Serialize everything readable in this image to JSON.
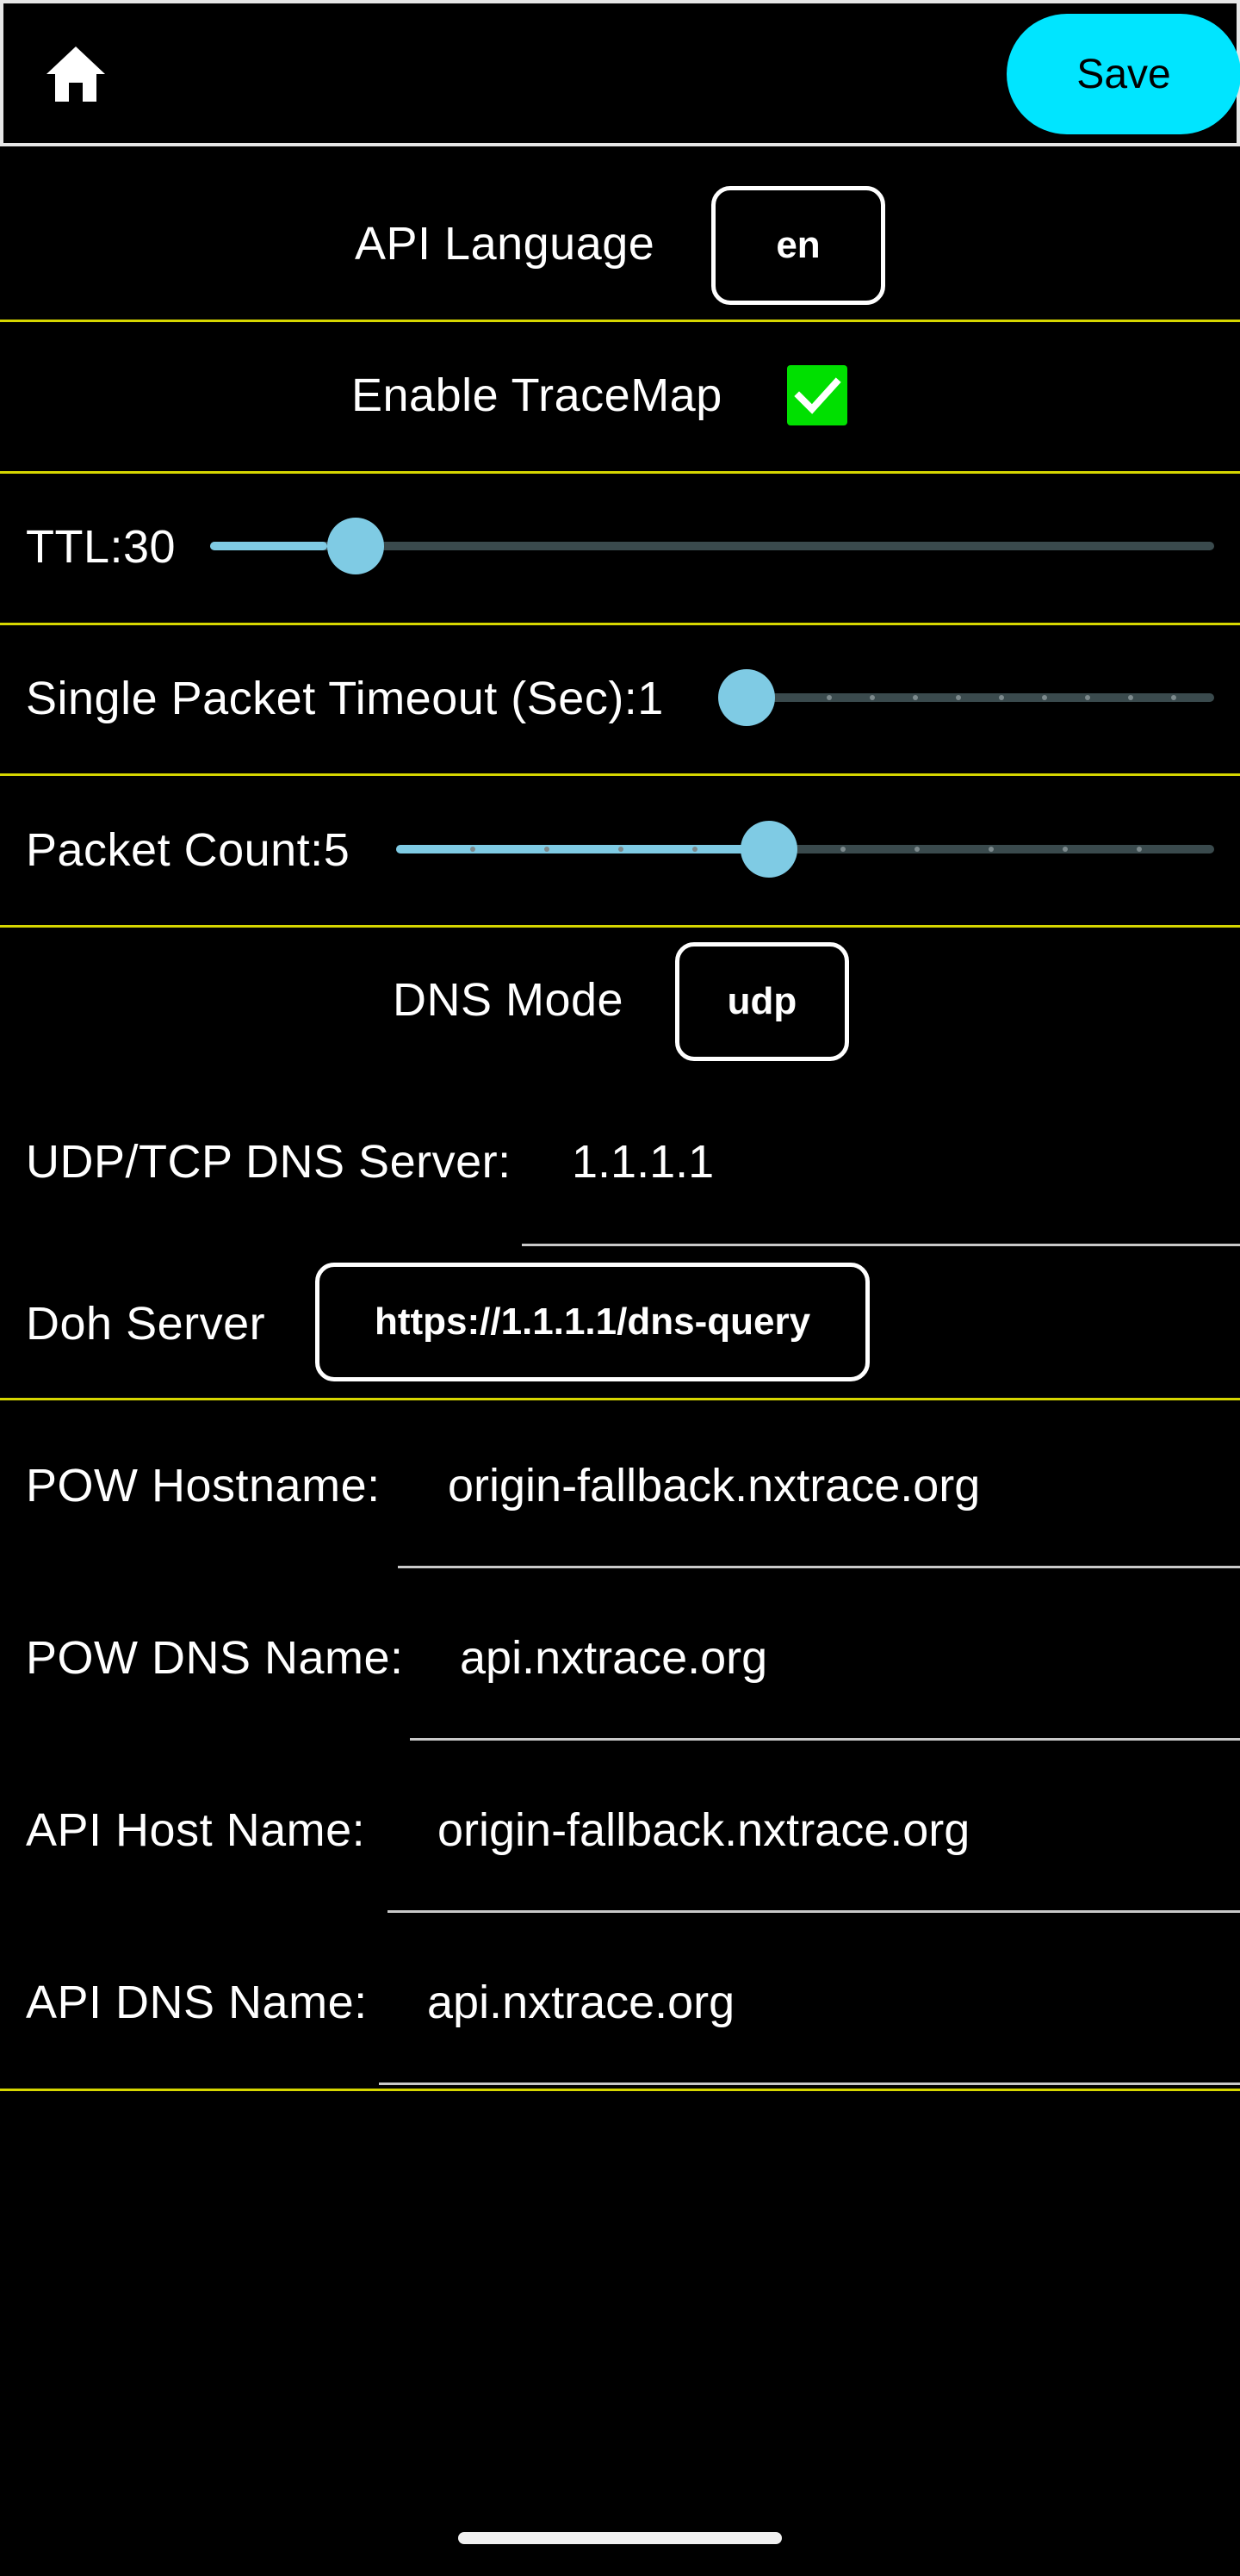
{
  "header": {
    "home_icon": "home-icon",
    "save_label": "Save"
  },
  "api_language": {
    "label": "API Language",
    "value": "en"
  },
  "tracemap": {
    "label": "Enable TraceMap",
    "checked": true
  },
  "ttl": {
    "label": "TTL:30",
    "value": 30,
    "fraction": 0.117
  },
  "timeout": {
    "label": "Single Packet Timeout (Sec):1",
    "value": 1,
    "fraction": 0.0
  },
  "packet_count": {
    "label": "Packet Count:5",
    "value": 5,
    "fraction": 0.45
  },
  "dns_mode": {
    "label": "DNS Mode",
    "value": "udp"
  },
  "udp_dns": {
    "label": "UDP/TCP DNS Server:",
    "value": "1.1.1.1"
  },
  "doh": {
    "label": "Doh Server",
    "value": "https://1.1.1.1/dns-query"
  },
  "pow_hostname": {
    "label": "POW Hostname:",
    "value": "origin-fallback.nxtrace.org"
  },
  "pow_dns": {
    "label": "POW DNS Name:",
    "value": "api.nxtrace.org"
  },
  "api_host": {
    "label": "API Host Name:",
    "value": "origin-fallback.nxtrace.org"
  },
  "api_dns": {
    "label": "API DNS Name:",
    "value": "api.nxtrace.org"
  },
  "colors": {
    "accent": "#00e5ff",
    "divider": "#d6d600",
    "slider": "#7fcbe4",
    "checkbox": "#00e000"
  }
}
